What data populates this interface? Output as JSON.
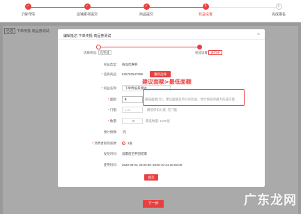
{
  "steps": [
    {
      "label": "了解详情",
      "num": "✓",
      "state": "done"
    },
    {
      "label": "店铺素材提交",
      "num": "✓",
      "state": "done"
    },
    {
      "label": "商品提交",
      "num": "✓",
      "state": "done"
    },
    {
      "label": "权益设置",
      "num": "4",
      "state": "current"
    },
    {
      "label": "完成报名",
      "num": "5",
      "state": "pending"
    }
  ],
  "background": {
    "tag": "已选",
    "title": "下单传抵-商品券测试",
    "next_label": "下一步"
  },
  "modal": {
    "title": "编辑抵达-下单传抵-商品券测试",
    "close": "×",
    "substeps": {
      "left_prefix": "选择商品:",
      "left_tag": "已完成",
      "right_prefix": "权益设置",
      "right_tag": "进行中"
    },
    "fields": {
      "benefit_type_label": "权益类型:",
      "benefit_type_value": "商品优惠券",
      "select_goods_label": "选择商品:",
      "goods_id": "626792547099",
      "reselect_label": "重新选择",
      "benefit_name_label": "权益名称:",
      "benefit_name_value": "下单传抵券测试",
      "face_value_label": "面额:",
      "face_value_value": "8",
      "face_value_hint": "最低面额(元)，建议面额是单价的比值，预计将获得最大的成交量",
      "threshold_label": "门槛:",
      "threshold_placeholder": "1.01",
      "threshold_hint": "最低折扣力度: 无门槛",
      "quantity_label": "数量:",
      "quantity_value": "0",
      "quantity_hint": "最低数量: 1000张",
      "budget_label": "预计预算:",
      "budget_value": "-元",
      "limit_label": "消费者限领张数:",
      "limit_option": "1张",
      "issue_label": "发放时间:",
      "issue_value": "设置后至开团结束",
      "use_label": "使用时间:",
      "use_value": "2020-09-01 00:00:00~2020-10-31 00:00:00"
    },
    "confirm_label": "提交"
  },
  "annotation": "建议面额>最低面额",
  "watermark": "广东龙网",
  "colors": {
    "accent": "#e84040",
    "mask": "#9a9a9a"
  }
}
